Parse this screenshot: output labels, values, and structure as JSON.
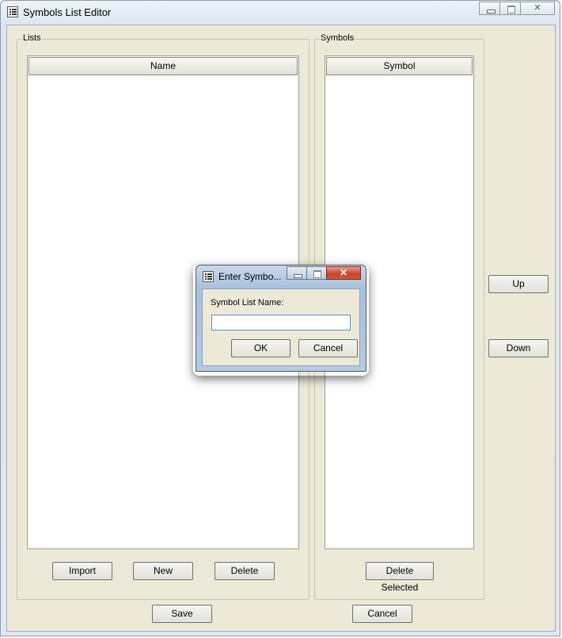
{
  "window": {
    "title": "Symbols List Editor"
  },
  "lists_group": {
    "title": "Lists",
    "column_header": "Name",
    "buttons": {
      "import": "Import",
      "new": "New",
      "delete": "Delete"
    }
  },
  "symbols_group": {
    "title": "Symbols",
    "column_header": "Symbol",
    "buttons": {
      "delete_selected": "Delete Selected"
    }
  },
  "side_buttons": {
    "up": "Up",
    "down": "Down"
  },
  "bottom_buttons": {
    "save": "Save",
    "cancel": "Cancel"
  },
  "dialog": {
    "title": "Enter Symbo...",
    "label": "Symbol List Name:",
    "input_value": "",
    "ok": "OK",
    "cancel": "Cancel"
  }
}
